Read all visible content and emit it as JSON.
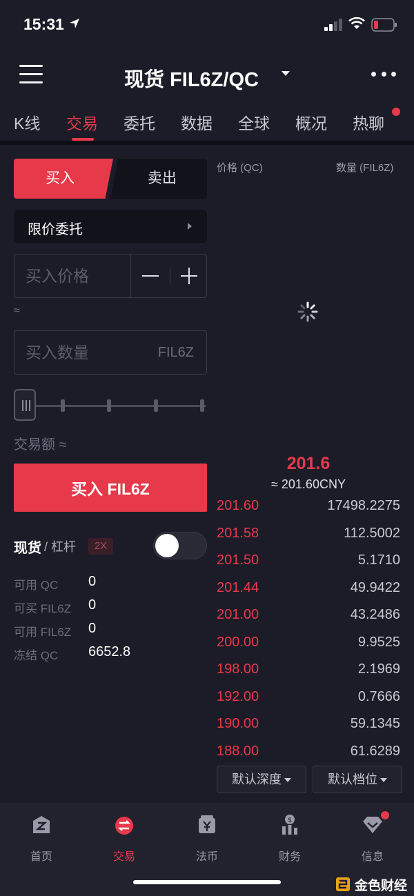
{
  "status_bar": {
    "time": "15:31"
  },
  "header": {
    "title": "现货 FIL6Z/QC"
  },
  "tabs": [
    {
      "label": "K线"
    },
    {
      "label": "交易"
    },
    {
      "label": "委托"
    },
    {
      "label": "数据"
    },
    {
      "label": "全球"
    },
    {
      "label": "概况"
    },
    {
      "label": "热聊"
    }
  ],
  "trade": {
    "buy_label": "买入",
    "sell_label": "卖出",
    "order_type": "限价委托",
    "price_placeholder": "买入价格",
    "approx": "≈",
    "qty_placeholder": "买入数量",
    "qty_unit": "FIL6Z",
    "amount_label": "交易额 ≈",
    "buy_button": "买入 FIL6Z",
    "spot_label": "现货",
    "margin_label": "/ 杠杆",
    "leverage": "2X",
    "balances": [
      {
        "label": "可用 QC",
        "value": "0"
      },
      {
        "label": "可买 FIL6Z",
        "value": "0"
      },
      {
        "label": "可用 FIL6Z",
        "value": "0"
      },
      {
        "label": "冻结 QC",
        "value": "6652.8"
      }
    ]
  },
  "orderbook": {
    "price_header": "价格 (QC)",
    "qty_header": "数量 (FIL6Z)",
    "last_price": "201.6",
    "last_cny": "≈ 201.60CNY",
    "bids": [
      {
        "price": "201.60",
        "qty": "17498.2275"
      },
      {
        "price": "201.58",
        "qty": "112.5002"
      },
      {
        "price": "201.50",
        "qty": "5.1710"
      },
      {
        "price": "201.44",
        "qty": "49.9422"
      },
      {
        "price": "201.00",
        "qty": "43.2486"
      },
      {
        "price": "200.00",
        "qty": "9.9525"
      },
      {
        "price": "198.00",
        "qty": "2.1969"
      },
      {
        "price": "192.00",
        "qty": "0.7666"
      },
      {
        "price": "190.00",
        "qty": "59.1345"
      },
      {
        "price": "188.00",
        "qty": "61.6289"
      }
    ],
    "depth_btn": "默认深度",
    "level_btn": "默认档位"
  },
  "bottom_nav": [
    {
      "label": "首页"
    },
    {
      "label": "交易"
    },
    {
      "label": "法币"
    },
    {
      "label": "财务"
    },
    {
      "label": "信息"
    }
  ],
  "watermark": "金色财经",
  "colors": {
    "accent": "#e6394a",
    "background": "#1c1c28",
    "panel": "#12121a"
  }
}
